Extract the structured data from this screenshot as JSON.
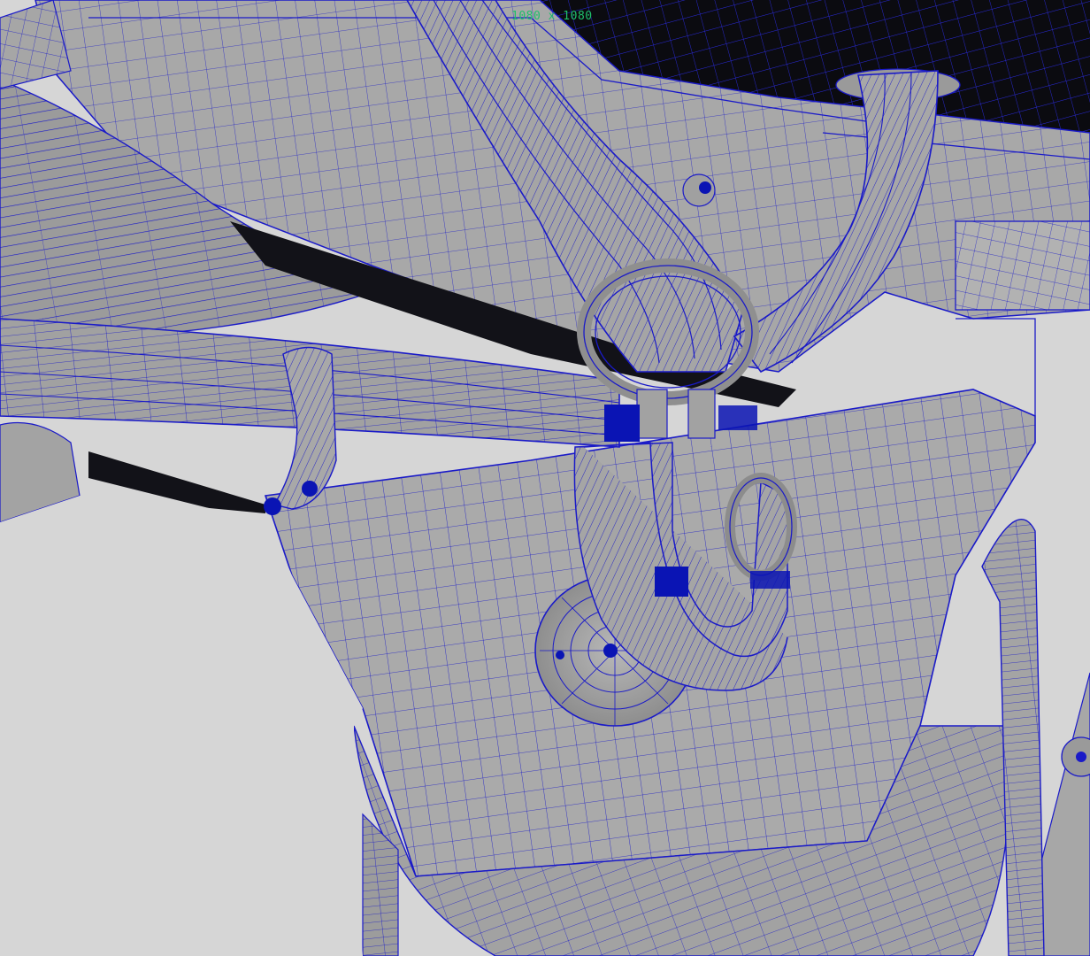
{
  "viewport": {
    "resolution_gate_label": "1080 x 1080",
    "background_color": "#d6d6d6",
    "wireframe_color": "#1a1ac8",
    "shaded_color": "#a9a9a9",
    "selected_color": "#0a14b4",
    "label_color": "#1fbf6a"
  }
}
